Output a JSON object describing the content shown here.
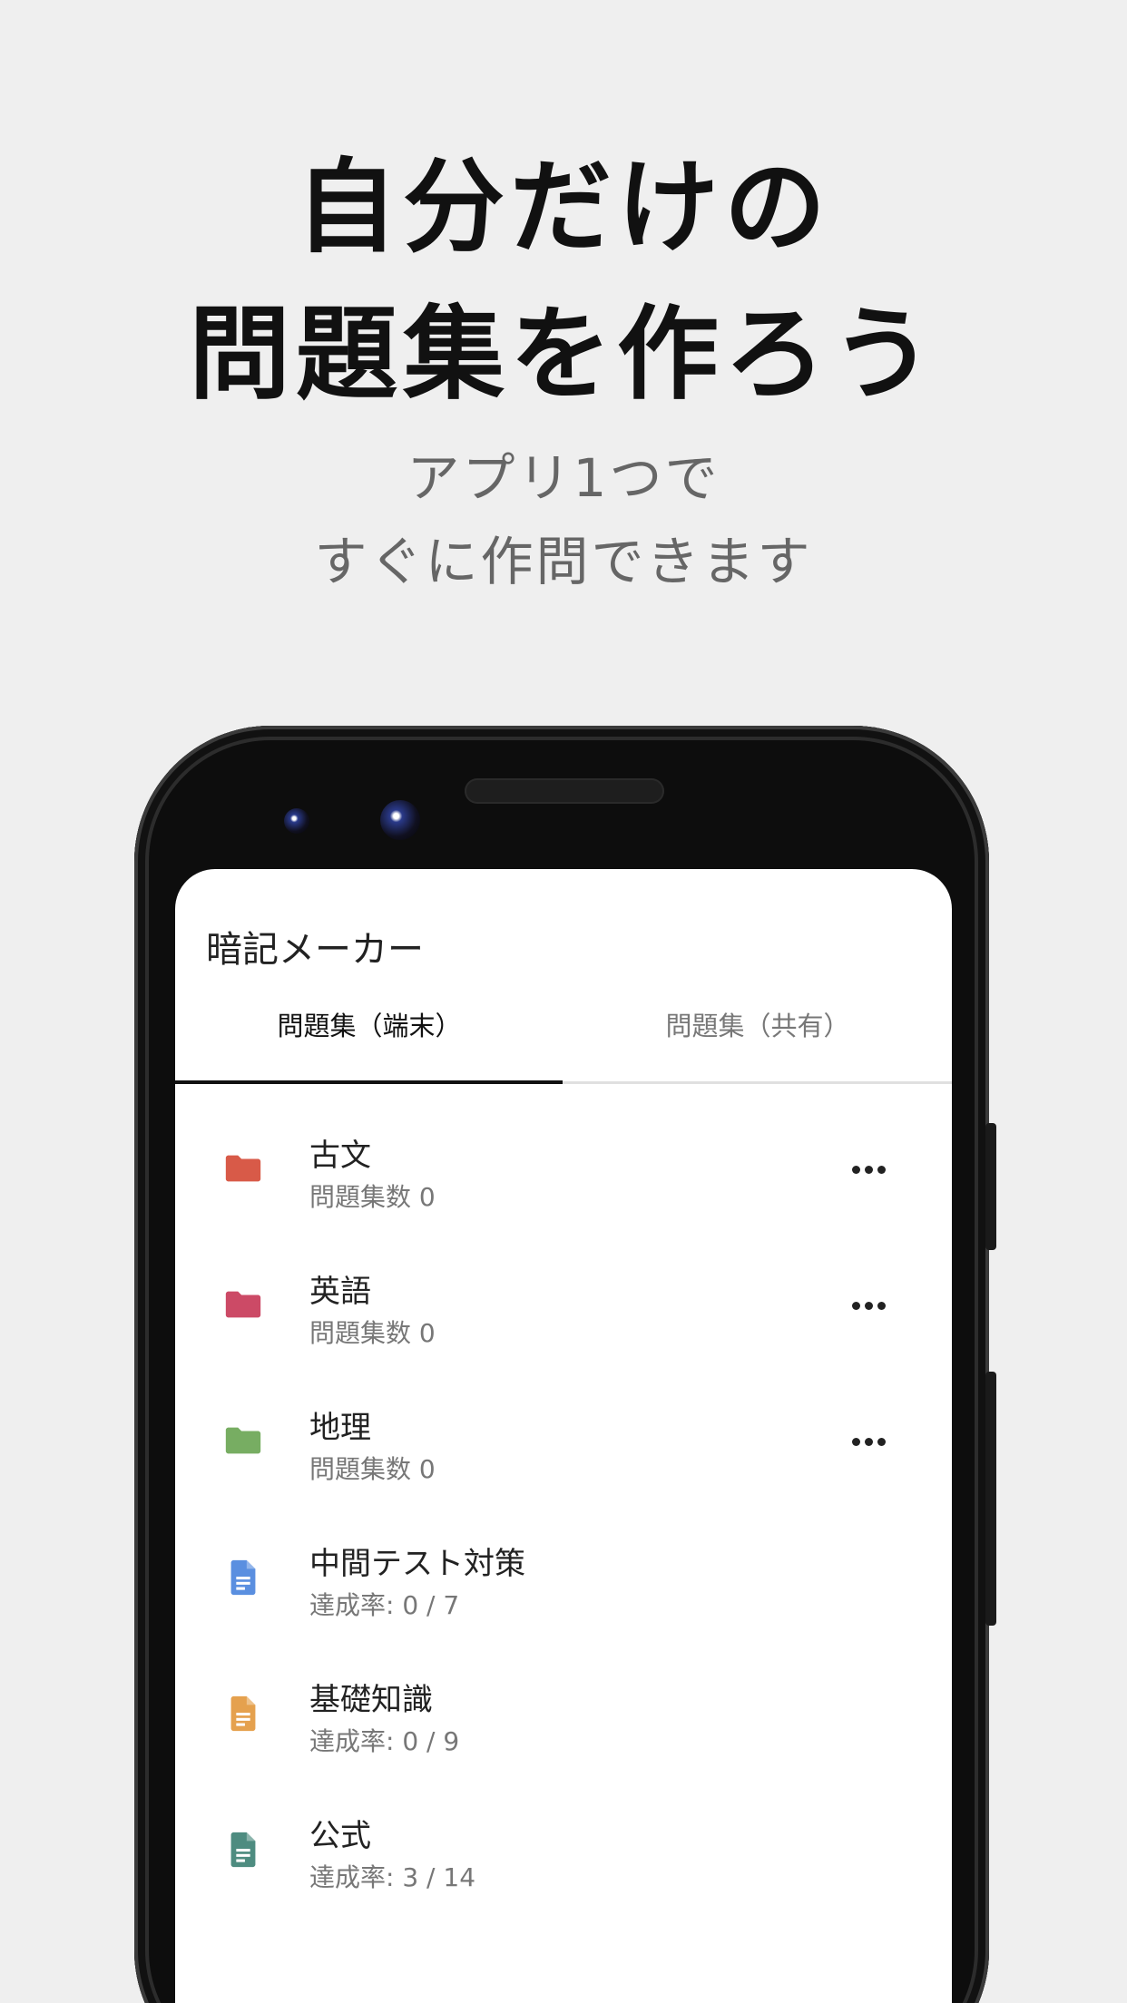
{
  "headline": {
    "line1": "自分だけの",
    "line2": "問題集を作ろう"
  },
  "subheadline": {
    "line1": "アプリ1つで",
    "line2": "すぐに作問できます"
  },
  "app": {
    "title": "暗記メーカー",
    "tabs": [
      {
        "label": "問題集（端末）",
        "active": true
      },
      {
        "label": "問題集（共有）",
        "active": false
      }
    ],
    "items": [
      {
        "type": "folder",
        "icon": "folder-icon",
        "color": "#d85a48",
        "title": "古文",
        "subtitle": "問題集数 0",
        "has_menu": true
      },
      {
        "type": "folder",
        "icon": "folder-icon",
        "color": "#cc4a66",
        "title": "英語",
        "subtitle": "問題集数 0",
        "has_menu": true
      },
      {
        "type": "folder",
        "icon": "folder-icon",
        "color": "#77ad62",
        "title": "地理",
        "subtitle": "問題集数 0",
        "has_menu": true
      },
      {
        "type": "file",
        "icon": "document-icon",
        "color": "#5a8fe0",
        "title": "中間テスト対策",
        "subtitle": "達成率: 0 / 7",
        "has_menu": false
      },
      {
        "type": "file",
        "icon": "document-icon",
        "color": "#e5a14e",
        "title": "基礎知識",
        "subtitle": "達成率: 0 / 9",
        "has_menu": false
      },
      {
        "type": "file",
        "icon": "document-icon",
        "color": "#4e8c80",
        "title": "公式",
        "subtitle": "達成率: 3 / 14",
        "has_menu": false
      }
    ]
  }
}
